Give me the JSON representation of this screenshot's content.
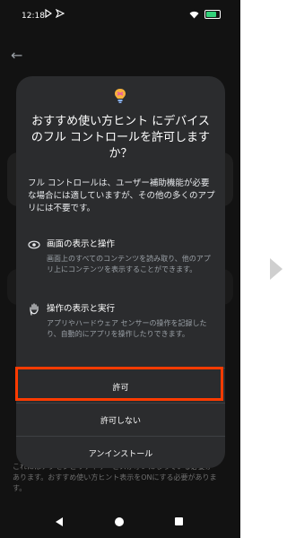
{
  "status": {
    "time": "12:18"
  },
  "background": {
    "footer_text": "これにはアクセシビリティサービスがオンになっている必要があります。おすすめ使い方ヒント表示をONにする必要があります。"
  },
  "dialog": {
    "title": "おすすめ使い方ヒント にデバイスのフル コントロールを許可しますか？",
    "body": "フル コントロールは、ユーザー補助機能が必要な場合には適していますが、その他の多くのアプリには不要です。",
    "permissions": [
      {
        "title": "画面の表示と操作",
        "desc": "画面上のすべてのコンテンツを読み取り、他のアプリ上にコンテンツを表示することができます。"
      },
      {
        "title": "操作の表示と実行",
        "desc": "アプリやハードウェア センサーの操作を記録したり、自動的にアプリを操作したりできます。"
      }
    ],
    "buttons": {
      "allow": "許可",
      "deny": "許可しない",
      "uninstall": "アンインストール"
    }
  },
  "colors": {
    "highlight": "#ff3b00",
    "dialog_bg": "#2b2c2e",
    "screen_bg": "#121212"
  }
}
